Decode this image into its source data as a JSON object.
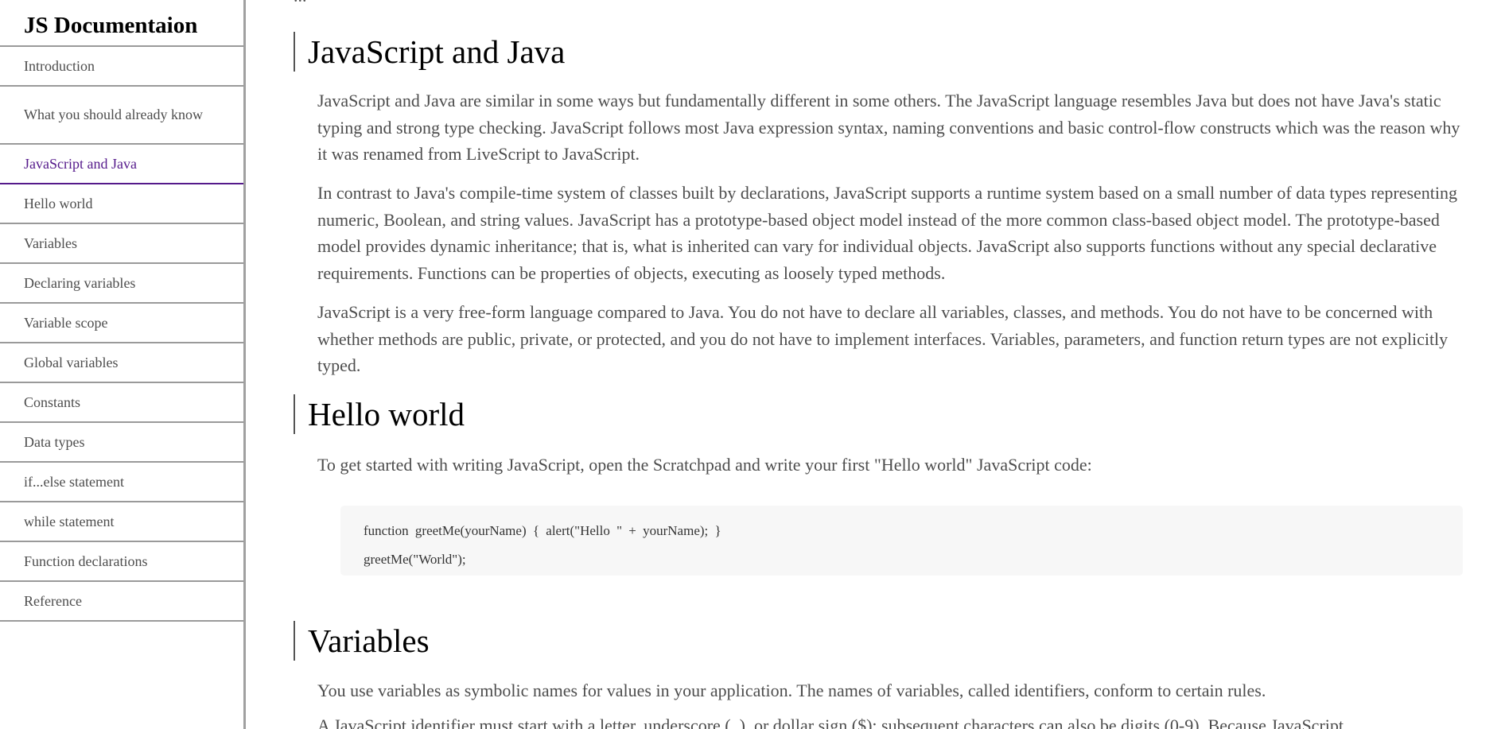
{
  "navbar": {
    "title": "JS Documentaion",
    "items": [
      {
        "label": "Introduction"
      },
      {
        "label": "What you should already know"
      },
      {
        "label": "JavaScript and Java"
      },
      {
        "label": "Hello world"
      },
      {
        "label": "Variables"
      },
      {
        "label": "Declaring variables"
      },
      {
        "label": "Variable scope"
      },
      {
        "label": "Global variables"
      },
      {
        "label": "Constants"
      },
      {
        "label": "Data types"
      },
      {
        "label": "if...else statement"
      },
      {
        "label": "while statement"
      },
      {
        "label": "Function declarations"
      },
      {
        "label": "Reference"
      }
    ],
    "active_item": "JavaScript and Java"
  },
  "main": {
    "cut_text": "...",
    "sections": [
      {
        "title": "JavaScript and Java",
        "paragraphs": [
          "JavaScript and Java are similar in some ways but fundamentally different in some others. The JavaScript language resembles Java but does not have Java's static typing and strong type checking. JavaScript follows most Java expression syntax, naming conventions and basic control-flow constructs which was the reason why it was renamed from LiveScript to JavaScript.",
          "In contrast to Java's compile-time system of classes built by declarations, JavaScript supports a runtime system based on a small number of data types representing numeric, Boolean, and string values. JavaScript has a prototype-based object model instead of the more common class-based object model. The prototype-based model provides dynamic inheritance; that is, what is inherited can vary for individual objects. JavaScript also supports functions without any special declarative requirements. Functions can be properties of objects, executing as loosely typed methods.",
          "JavaScript is a very free-form language compared to Java. You do not have to declare all variables, classes, and methods. You do not have to be concerned with whether methods are public, private, or protected, and you do not have to implement interfaces. Variables, parameters, and function return types are not explicitly typed."
        ]
      },
      {
        "title": "Hello world",
        "paragraphs": [
          "To get started with writing JavaScript, open the Scratchpad and write your first \"Hello world\" JavaScript code:"
        ],
        "code": [
          "function greetMe(yourName) { alert(\"Hello \" + yourName); }",
          "greetMe(\"World\");"
        ]
      },
      {
        "title": "Variables",
        "paragraphs": [
          "You use variables as symbolic names for values in your application. The names of variables, called identifiers, conform to certain rules.",
          "A JavaScript identifier must start with a letter, underscore (_), or dollar sign ($); subsequent characters can also be digits (0-9). Because JavaScript"
        ]
      }
    ]
  }
}
